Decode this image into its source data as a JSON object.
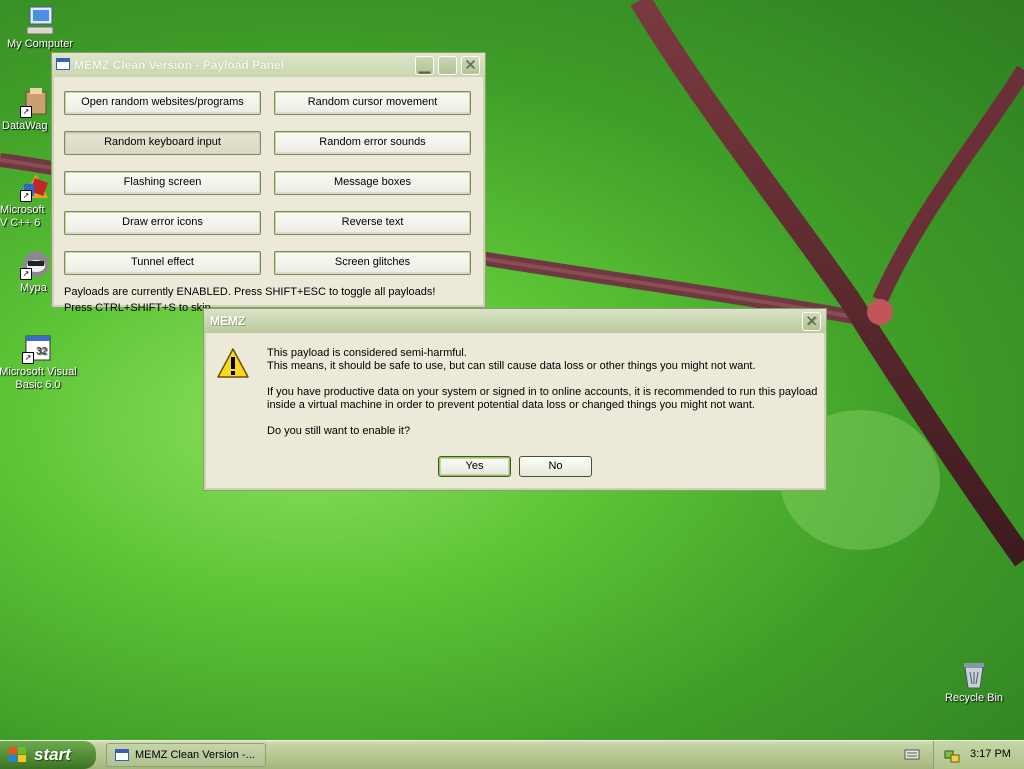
{
  "desktop": {
    "icons": [
      {
        "label": "My Computer",
        "icon": "computer-icon"
      },
      {
        "label": "DataWag",
        "icon": "datawag-shortcut-icon"
      },
      {
        "label": "Microsoft V C++ 6",
        "icon": "visual-cpp-shortcut-icon"
      },
      {
        "label": "Mypa",
        "icon": "mypal-shortcut-icon"
      },
      {
        "label": "Microsoft Visual Basic 6.0",
        "icon": "visual-basic-shortcut-icon"
      },
      {
        "label": "Recycle Bin",
        "icon": "recycle-bin-icon"
      }
    ]
  },
  "payload_panel": {
    "title": "MEMZ Clean Version - Payload Panel",
    "buttons": [
      "Open random websites/programs",
      "Random cursor movement",
      "Random keyboard input",
      "Random error sounds",
      "Flashing screen",
      "Message boxes",
      "Draw error icons",
      "Reverse text",
      "Tunnel effect",
      "Screen glitches"
    ],
    "status_line1": "Payloads are currently ENABLED. Press SHIFT+ESC to toggle all payloads!",
    "status_line2": "Press CTRL+SHIFT+S to skip"
  },
  "dialog": {
    "title": "MEMZ",
    "icon": "warning-icon",
    "line1": "This payload is considered semi-harmful.",
    "line2": "This means, it should be safe to use, but can still cause data loss or other things you might not want.",
    "line3": "If you have productive data on your system or signed in to online accounts, it is recommended to run this payload",
    "line4": "inside a virtual machine in order to prevent potential data loss or changed things you might not want.",
    "line5": "Do you still want to enable it?",
    "yes_label": "Yes",
    "no_label": "No"
  },
  "taskbar": {
    "start_label": "start",
    "task_item": "MEMZ Clean Version -...",
    "clock": "3:17 PM"
  }
}
